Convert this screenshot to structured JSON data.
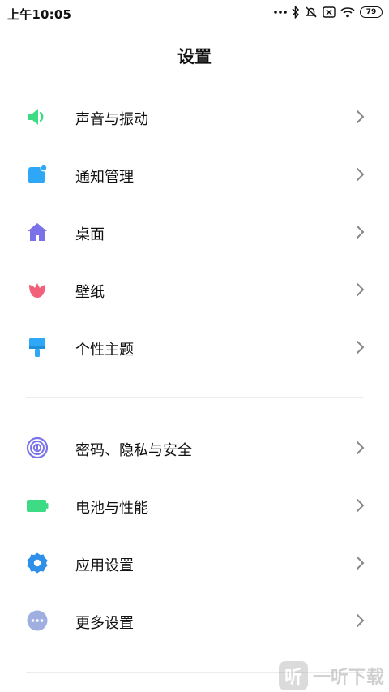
{
  "status": {
    "time": "上午10:05",
    "battery": "79",
    "icons": [
      "more-dots-icon",
      "bluetooth-icon",
      "alarm-off-icon",
      "sim-off-icon",
      "wifi-icon",
      "battery-icon"
    ]
  },
  "page": {
    "title": "设置"
  },
  "groups": [
    [
      {
        "label": "声音与振动",
        "icon": "speaker-icon",
        "color": "#3ddc84"
      },
      {
        "label": "通知管理",
        "icon": "notification-icon",
        "color": "#2ea8f6"
      },
      {
        "label": "桌面",
        "icon": "home-icon",
        "color": "#7b72e9"
      },
      {
        "label": "壁纸",
        "icon": "tulip-icon",
        "color": "#f2607a"
      },
      {
        "label": "个性主题",
        "icon": "brush-icon",
        "color": "#2ea8f6"
      }
    ],
    [
      {
        "label": "密码、隐私与安全",
        "icon": "fingerprint-icon",
        "color": "#7b72e9"
      },
      {
        "label": "电池与性能",
        "icon": "battery-icon",
        "color": "#3ddc84"
      },
      {
        "label": "应用设置",
        "icon": "gear-icon",
        "color": "#2e90e8"
      },
      {
        "label": "更多设置",
        "icon": "more-icon",
        "color": "#9fb0e0"
      }
    ]
  ],
  "watermark": {
    "text": "一听下载",
    "glyph": "听"
  }
}
